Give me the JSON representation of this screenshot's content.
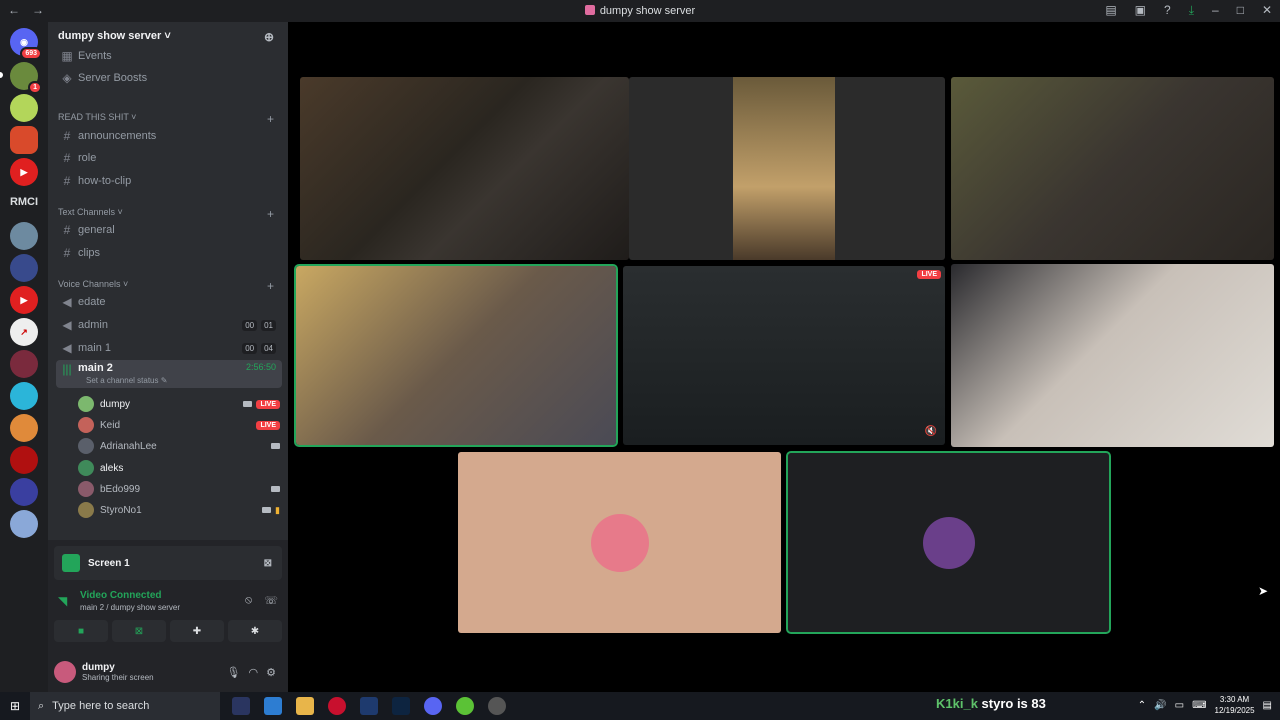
{
  "titlebar": {
    "title": "dumpy show server",
    "back": "←",
    "forward": "→"
  },
  "guilds": {
    "badge_dm": "693",
    "badge_2": "1",
    "rmci_label": "RMCI"
  },
  "server": {
    "name": "dumpy show server ˅",
    "events": "Events",
    "boosts": "Server Boosts",
    "categories": {
      "read": "READ THIS SHIT ˅",
      "text": "Text Channels ˅",
      "voice": "Voice Channels ˅"
    },
    "read_channels": [
      "announcements",
      "role",
      "how-to-clip"
    ],
    "text_channels": [
      "general",
      "clips"
    ],
    "voice_channels": [
      {
        "name": "edate"
      },
      {
        "name": "admin",
        "count": "00",
        "limit": "01"
      },
      {
        "name": "main 1",
        "count": "00",
        "limit": "04"
      }
    ],
    "active_voice": {
      "name": "main 2",
      "timer": "2:56:50",
      "status": "Set a channel status ✎"
    },
    "members": [
      {
        "name": "dumpy",
        "live": "LIVE"
      },
      {
        "name": "Keid",
        "live": "LIVE"
      },
      {
        "name": "AdrianahLee"
      },
      {
        "name": "aleks"
      },
      {
        "name": "bEdo999"
      },
      {
        "name": "StyroNo1"
      }
    ]
  },
  "panel": {
    "screen": "Screen 1",
    "connected": "Video Connected",
    "location": "main 2 / dumpy show server",
    "user": "dumpy",
    "user_status": "Sharing their screen"
  },
  "stage": {
    "live_badge": "LIVE"
  },
  "taskbar": {
    "search_placeholder": "Type here to search",
    "ticker_nick": "K1ki_k",
    "ticker_text": "styro is 83",
    "time": "3:30 AM",
    "date": "12/19/2025"
  },
  "colors": {
    "accent_green": "#23a55a",
    "live_red": "#f23f43",
    "sidebar": "#2b2d31",
    "guild_bar": "#1e1f22"
  }
}
